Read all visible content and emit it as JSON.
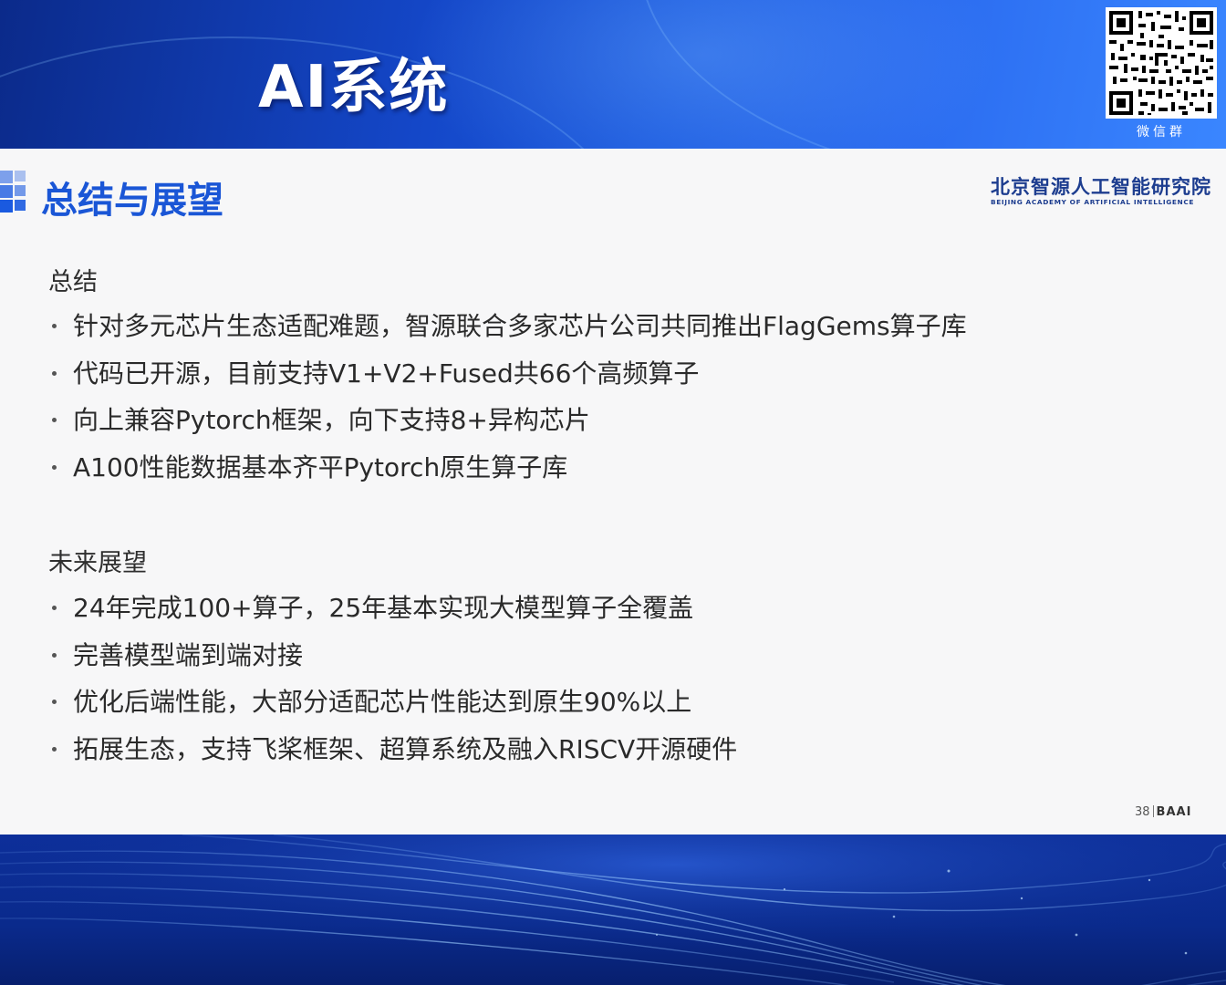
{
  "header": {
    "event_title": "AI系统",
    "qr_caption": "微信群"
  },
  "slide": {
    "section_title": "总结与展望",
    "org": {
      "name_cn": "北京智源人工智能研究院",
      "name_en": "BEIJING ACADEMY OF ARTIFICIAL INTELLIGENCE"
    },
    "summary": {
      "heading": "总结",
      "items": [
        "针对多元芯片生态适配难题，智源联合多家芯片公司共同推出FlagGems算子库",
        "代码已开源，目前支持V1+V2+Fused共66个高频算子",
        "向上兼容Pytorch框架，向下支持8+异构芯片",
        "A100性能数据基本齐平Pytorch原生算子库"
      ]
    },
    "outlook": {
      "heading": "未来展望",
      "items": [
        "24年完成100+算子，25年基本实现大模型算子全覆盖",
        "完善模型端到端对接",
        "优化后端性能，大部分适配芯片性能达到原生90%以上",
        "拓展生态，支持飞桨框架、超算系统及融入RISCV开源硬件"
      ]
    },
    "footer": {
      "page_number": "38",
      "brand": "BAAI"
    }
  },
  "colors": {
    "brand_blue": "#1a56d6",
    "header_blue": "#1447c8",
    "org_navy": "#1d3d8f"
  }
}
